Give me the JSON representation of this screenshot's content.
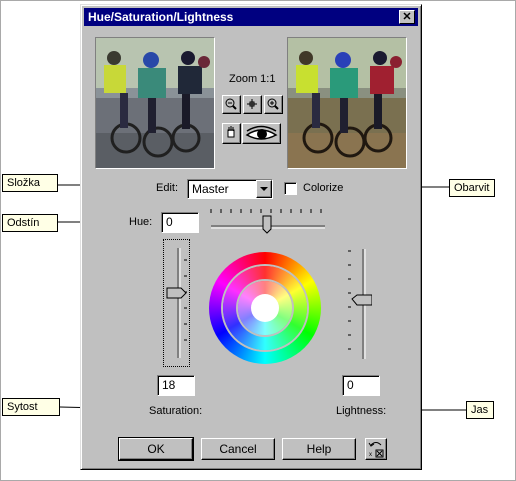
{
  "dialog": {
    "title": "Hue/Saturation/Lightness",
    "close_glyph": "✕",
    "zoom_label": "Zoom 1:1",
    "edit_label": "Edit:",
    "edit_value": "Master",
    "colorize_label": "Colorize",
    "colorize_checked": false,
    "hue_label": "Hue:",
    "hue_value": "0",
    "saturation_value": "18",
    "saturation_label": "Saturation:",
    "lightness_value": "0",
    "lightness_label": "Lightness:",
    "buttons": {
      "ok": "OK",
      "cancel": "Cancel",
      "help": "Help"
    }
  },
  "callouts": {
    "slozka": "Složka",
    "odstin": "Odstín",
    "sytost": "Sytost",
    "obarvit": "Obarvit",
    "jas": "Jas"
  },
  "icons": [
    "close-icon",
    "zoom-out-icon",
    "move-icon",
    "zoom-in-icon",
    "pan-hand-icon",
    "eye-preview-icon",
    "dropdown-arrow-icon",
    "reset-icon"
  ],
  "colors": {
    "titlebar": "#000080",
    "dialog_bg": "#c0c0c0",
    "callout_bg": "#ffffe6"
  }
}
